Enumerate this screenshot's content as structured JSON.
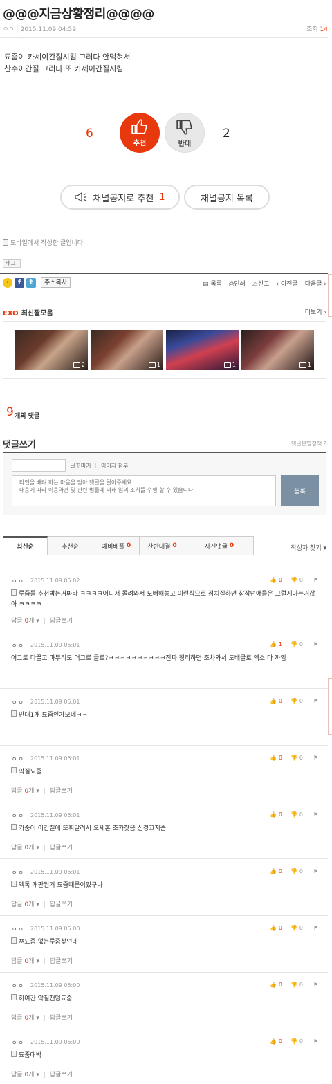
{
  "post": {
    "title": "@@@지금상황정리@@@@",
    "author": "ㅇㅇ",
    "datetime": "2015.11.09 04:59",
    "views_label": "조회",
    "views": "14",
    "body_lines": [
      "됴줌이 카세이간질시킴 그러다 안먹혀서",
      "찬수이간질 그러다 또 카세이간질시킴"
    ],
    "mobile_note": "모바일에서 작성한 글입니다.",
    "tag_label": "태그"
  },
  "vote": {
    "up_count": "6",
    "up_label": "추천",
    "down_count": "2",
    "down_label": "반대"
  },
  "actions": {
    "channel_notice_recommend": "채널공지로 추천",
    "channel_notice_recommend_count": "1",
    "channel_notice_list": "채널공지 목록"
  },
  "share": {
    "copy_address": "주소복사",
    "list": "목록",
    "print": "인쇄",
    "report": "신고",
    "prev": "이전글",
    "next": "다음글"
  },
  "clips": {
    "brand": "EXO",
    "title": "최신짤모음",
    "more": "더보기",
    "items": [
      {
        "count": "2"
      },
      {
        "count": "1"
      },
      {
        "count": "1"
      },
      {
        "count": "1"
      }
    ]
  },
  "comments_header": {
    "count": "9",
    "count_label": "개의 댓글"
  },
  "write": {
    "title": "댓글쓰기",
    "policy": "댓글운영정책",
    "decorate": "글꾸미기",
    "attach_image": "이미지 첨부",
    "placeholder": "타인을 배려 하는 마음을 담아 댓글을 달아주세요.\n내용에 따라 이용약관 및 관련 법률에 의해 임의 조치를 수행 할 수 있습니다.",
    "submit": "등록"
  },
  "sort_tabs": [
    {
      "label": "최신순",
      "count": ""
    },
    {
      "label": "추천순",
      "count": ""
    },
    {
      "label": "예비베플",
      "count": "0"
    },
    {
      "label": "찬반대결",
      "count": "0"
    },
    {
      "label": "사진댓글",
      "count": "0"
    }
  ],
  "find_author": "작성자 찾기",
  "comments": [
    {
      "author": "ㅇㅇ",
      "time": "2015.11.09 05:02",
      "up": "0",
      "down": "0",
      "text": "루즘들 추천박는거봐라 ㅋㅋㅋㅋ어디서 몰려와서 도배해놓고 이런식으로 정치질하면 잠잠던애들은 그럴게아는거잖아 ㅋㅋㅋㅋ",
      "reply_label": "답글",
      "reply_count": "0",
      "reply_unit": "개",
      "write_reply": "답글쓰기",
      "has_icon": true
    },
    {
      "author": "ㅇㅇ",
      "time": "2015.11.09 05:01",
      "up": "1",
      "down": "0",
      "text": "어그로 다끌고 마무리도 어그로 글로?ㅋㅋㅋㅋㅋㅋㅋㅋㅋㅋ진짜 정리하면 조차와서 도배글로 엑소 다 까임",
      "reply_label": "",
      "reply_count": "",
      "reply_unit": "",
      "write_reply": "",
      "has_icon": false
    },
    {
      "author": "ㅇㅇ",
      "time": "2015.11.09 05:01",
      "up": "0",
      "down": "0",
      "text": "반대1개 됴줌인가보네ㅋㅋ",
      "reply_label": "",
      "reply_count": "",
      "reply_unit": "",
      "write_reply": "",
      "has_icon": true
    },
    {
      "author": "ㅇㅇ",
      "time": "2015.11.09 05:01",
      "up": "0",
      "down": "0",
      "text": "악질됴줌",
      "reply_label": "답글",
      "reply_count": "0",
      "reply_unit": "개",
      "write_reply": "답글쓰기",
      "has_icon": true
    },
    {
      "author": "ㅇㅇ",
      "time": "2015.11.09 05:01",
      "up": "0",
      "down": "0",
      "text": "카줌이 이간질에 또휘말려서 오세훈 조카찾음 신경끄지좀",
      "reply_label": "답글",
      "reply_count": "0",
      "reply_unit": "개",
      "write_reply": "답글쓰기",
      "has_icon": true
    },
    {
      "author": "ㅇㅇ",
      "time": "2015.11.09 05:01",
      "up": "0",
      "down": "0",
      "text": "엑톡 개판된거 됴줌때문이었구나",
      "reply_label": "답글",
      "reply_count": "0",
      "reply_unit": "개",
      "write_reply": "답글쓰기",
      "has_icon": true
    },
    {
      "author": "ㅇㅇ",
      "time": "2015.11.09 05:00",
      "up": "0",
      "down": "0",
      "text": "ㅉ됴줌 없는루줌찾던데",
      "reply_label": "답글",
      "reply_count": "0",
      "reply_unit": "개",
      "write_reply": "답글쓰기",
      "has_icon": true
    },
    {
      "author": "ㅇㅇ",
      "time": "2015.11.09 05:00",
      "up": "0",
      "down": "0",
      "text": "하여간 악질팬덤됴줌",
      "reply_label": "답글",
      "reply_count": "0",
      "reply_unit": "개",
      "write_reply": "답글쓰기",
      "has_icon": true
    },
    {
      "author": "ㅇㅇ",
      "time": "2015.11.09 05:00",
      "up": "0",
      "down": "0",
      "text": "됴줌대박",
      "reply_label": "답글",
      "reply_count": "0",
      "reply_unit": "개",
      "write_reply": "답글쓰기",
      "has_icon": true
    }
  ],
  "colors": {
    "accent": "#e8380d",
    "submit": "#7b91a3",
    "facebook": "#3b5998",
    "twitter": "#4fa7d6"
  }
}
